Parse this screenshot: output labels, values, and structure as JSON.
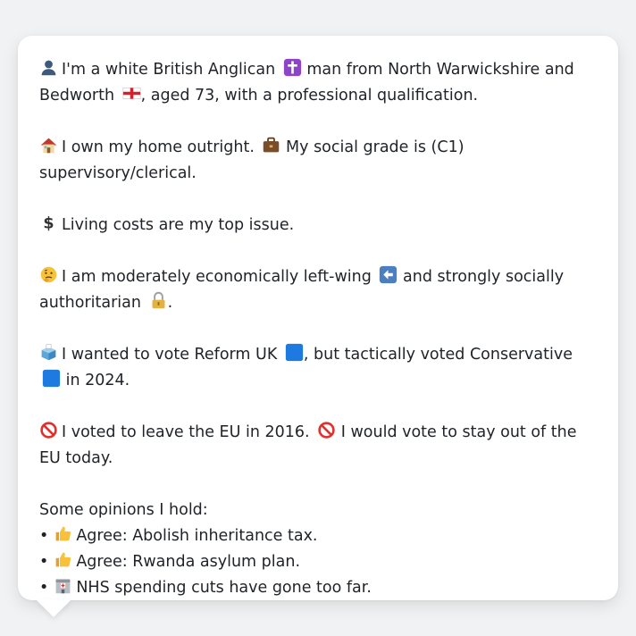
{
  "bio": {
    "identity": {
      "part1": "I'm a white British Anglican",
      "part2": "man from North Warwickshire and Bedworth",
      "part3": ", aged 73, with a professional qualification."
    },
    "home": {
      "part1": "I own my home outright.",
      "part2": "My social grade is (C1) supervisory/clerical."
    },
    "issue": "Living costs are my top issue.",
    "ideology": {
      "part1": "I am moderately economically left-wing",
      "part2": "and strongly socially authoritarian",
      "part3": "."
    },
    "vote": {
      "part1": "I wanted to vote Reform UK",
      "part2": ", but tactically voted Conservative",
      "part3": "in 2024."
    },
    "eu": {
      "part1": "I voted to leave the EU in 2016.",
      "part2": "I would vote to stay out of the EU today."
    }
  },
  "opinions": {
    "heading": "Some opinions I hold:",
    "bullet": "•",
    "items": [
      {
        "icon": "thumbs-up-icon",
        "text": "Agree: Abolish inheritance tax."
      },
      {
        "icon": "thumbs-up-icon",
        "text": "Agree: Rwanda asylum plan."
      },
      {
        "icon": "hospital-icon",
        "text": "NHS spending cuts have gone too far."
      }
    ]
  },
  "icons": {
    "person": "bust-silhouette-icon",
    "religion": "latin-cross-icon",
    "place": "england-flag-icon",
    "home": "house-icon",
    "job": "briefcase-icon",
    "issue": "dollar-sign-icon",
    "thinking": "thinking-face-icon",
    "left": "left-arrow-icon",
    "authoritarian": "locked-padlock-icon",
    "ballot": "ballot-box-icon",
    "party_colour": "blue-square-icon",
    "eu": "prohibited-icon"
  },
  "colors": {
    "background": "#f1f2f3",
    "bubble": "#ffffff",
    "text": "#1f2328",
    "party_blue": "#1e7ae0"
  }
}
